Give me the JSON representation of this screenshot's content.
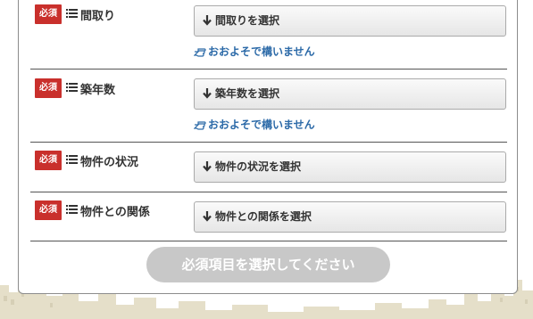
{
  "form": {
    "required_badge": "必須",
    "rows": [
      {
        "label": "間取り",
        "select_label": "間取りを選択",
        "hint": "おおよそで構いません"
      },
      {
        "label": "築年数",
        "select_label": "築年数を選択",
        "hint": "おおよそで構いません"
      },
      {
        "label": "物件の状況",
        "select_label": "物件の状況を選択"
      },
      {
        "label": "物件との関係",
        "select_label": "物件との関係を選択"
      }
    ],
    "submit_label": "必須項目を選択してください"
  },
  "colors": {
    "required_badge": "#c9302c",
    "hint_link": "#2c6aa8",
    "submit_disabled": "#c8c8c8",
    "skyline": "#e3dcc6"
  },
  "icons": {
    "list": "list-icon",
    "arrow": "arrow-down-icon",
    "hand": "hand-pointer-icon"
  }
}
